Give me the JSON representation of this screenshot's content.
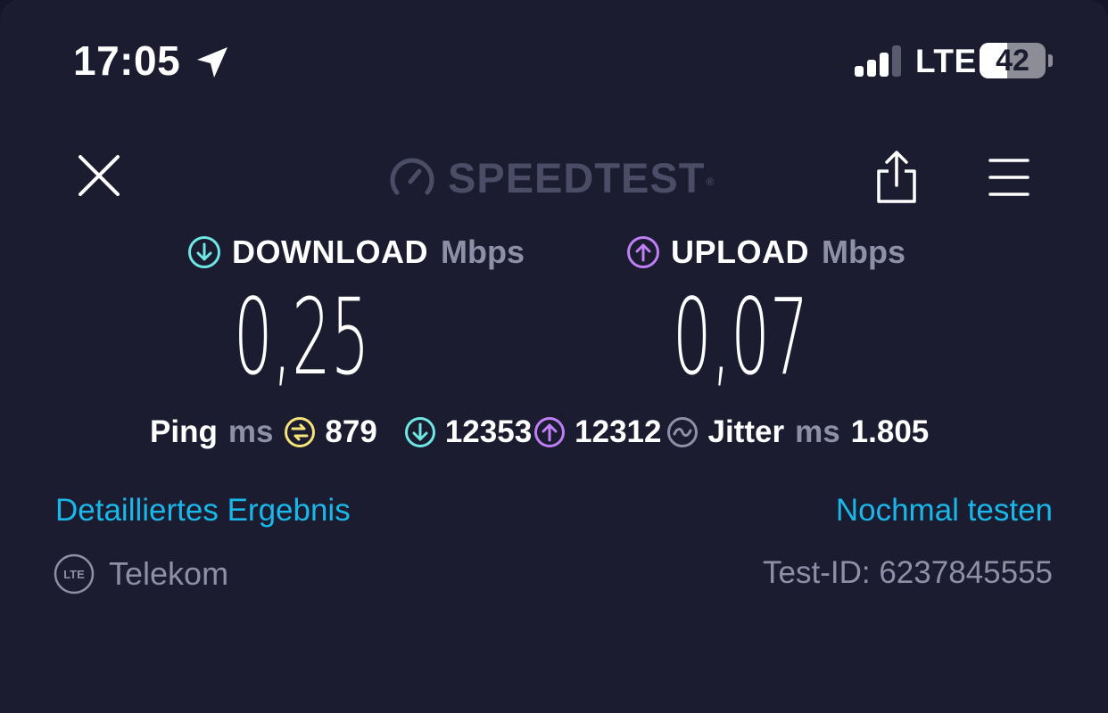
{
  "status_bar": {
    "time": "17:05",
    "network": "LTE",
    "battery_level": "42",
    "battery_fraction": 0.42,
    "signal_bars": 3,
    "signal_bars_total": 4
  },
  "header": {
    "logo_text": "SPEEDTEST",
    "logo_mark": "®"
  },
  "results": {
    "download": {
      "label": "DOWNLOAD",
      "unit": "Mbps",
      "value": "0,25"
    },
    "upload": {
      "label": "UPLOAD",
      "unit": "Mbps",
      "value": "0,07"
    }
  },
  "metrics": {
    "ping_label": "Ping",
    "ping_unit": "ms",
    "ping_value": "879",
    "download_latency": "12353",
    "upload_latency": "12312",
    "jitter_label": "Jitter",
    "jitter_unit": "ms",
    "jitter_value": "1.805"
  },
  "links": {
    "details": "Detailliertes Ergebnis",
    "retest": "Nochmal testen"
  },
  "footer": {
    "connection_badge": "LTE",
    "provider": "Telekom",
    "test_id": "Test-ID: 6237845555"
  },
  "colors": {
    "background": "#1b1c2f",
    "download_accent": "#6fe7e4",
    "upload_accent": "#bf7ff6",
    "ping_accent": "#f6e27a",
    "link": "#1ab7ea",
    "muted": "#8e90a8"
  },
  "icons": {
    "location": "location-arrow-icon",
    "signal": "cellular-signal-icon",
    "battery": "battery-icon",
    "close": "close-icon",
    "gauge": "speedometer-icon",
    "share": "share-icon",
    "menu": "hamburger-menu-icon",
    "download": "arrow-down-circle-icon",
    "upload": "arrow-up-circle-icon",
    "ping": "ping-icon",
    "jitter": "jitter-wave-icon",
    "connection": "lte-badge-icon"
  }
}
